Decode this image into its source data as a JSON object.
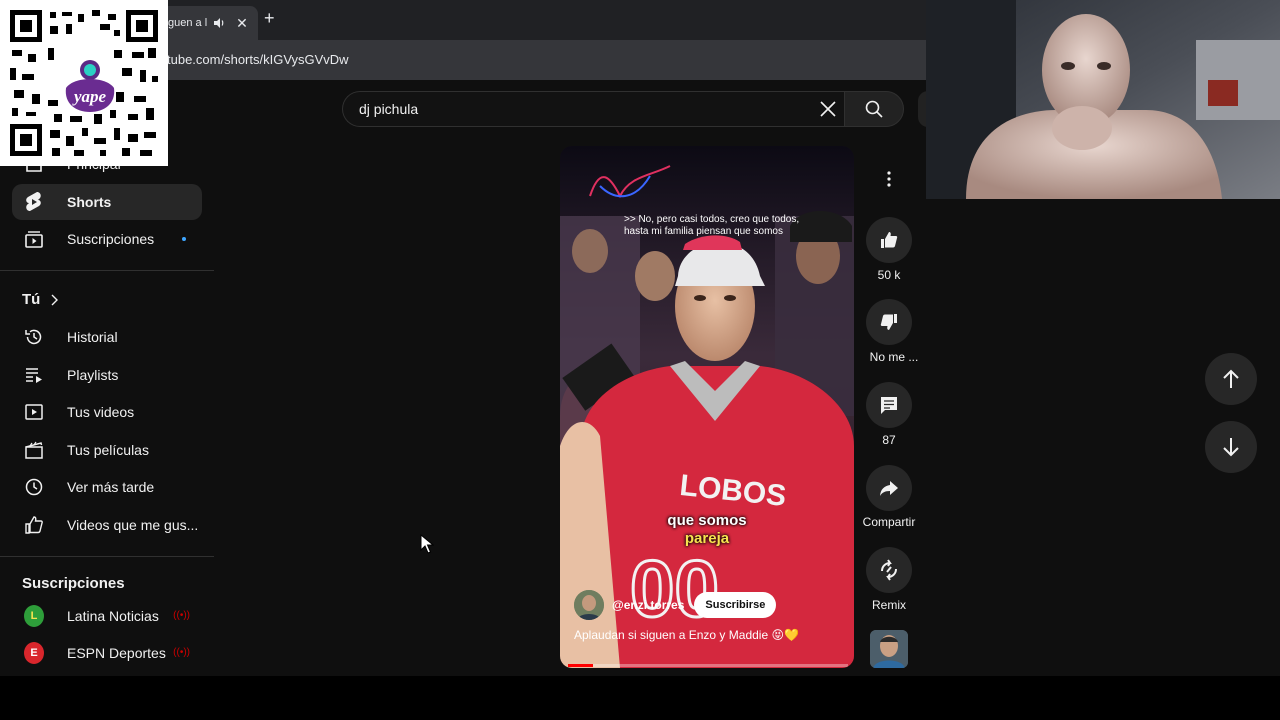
{
  "browser": {
    "tab_title": "guen a l",
    "url": "tube.com/shorts/kIGVysGVvDw",
    "new_tab_glyph": "+",
    "tab_close_glyph": "✕"
  },
  "qr": {
    "logo_text": "yape",
    "icon": "qr-code-icon"
  },
  "search": {
    "value": "dj pichula",
    "clear_icon": "close-icon",
    "search_icon": "search-icon"
  },
  "sidebar": {
    "top_items": [
      {
        "label": "Principal",
        "icon": "home-icon"
      },
      {
        "label": "Shorts",
        "icon": "shorts-icon"
      },
      {
        "label": "Suscripciones",
        "icon": "subscriptions-icon"
      }
    ],
    "you_title": "Tú",
    "you_items": [
      {
        "label": "Historial",
        "icon": "history-icon"
      },
      {
        "label": "Playlists",
        "icon": "playlist-icon"
      },
      {
        "label": "Tus videos",
        "icon": "video-icon"
      },
      {
        "label": "Tus películas",
        "icon": "movie-icon"
      },
      {
        "label": "Ver más tarde",
        "icon": "clock-icon"
      },
      {
        "label": "Videos que me gus...",
        "icon": "thumbs-up-icon"
      }
    ],
    "subs_title": "Suscripciones",
    "subs_items": [
      {
        "label": "Latina Noticias",
        "initial": "L",
        "color": "#2e9e3a"
      },
      {
        "label": "ESPN Deportes",
        "initial": "E",
        "color": "#d9262c"
      }
    ]
  },
  "player": {
    "overlay_line1": ">> No, pero casi todos, creo que todos,",
    "overlay_line2": "hasta mi familia piensan que somos",
    "caption_line1": "que somos",
    "caption_line2": "pareja",
    "jersey_text": "LOBOS",
    "channel": "@enzi.torres",
    "subscribe": "Suscribirse",
    "description": "Aplaudan si siguen a Enzo y Maddie 😝💛",
    "progress": 0.09
  },
  "actions": {
    "like_count": "50 k",
    "dislike_label": "No me ...",
    "comment_count": "87",
    "share_label": "Compartir",
    "remix_label": "Remix"
  },
  "colors": {
    "background": "#0f0f0f",
    "accent_red": "#ff0000",
    "caption_yellow": "#f7e34f",
    "unread_dot": "#3ea6ff"
  }
}
